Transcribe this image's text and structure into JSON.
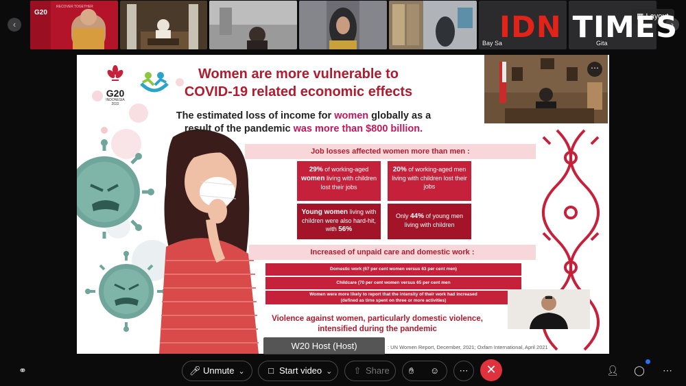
{
  "participants": [
    {
      "name": "",
      "bg": "#b3142a"
    },
    {
      "name": "",
      "bg": "#5a4632"
    },
    {
      "name": "",
      "bg": "#8c8c8c"
    },
    {
      "name": "",
      "bg": "#6f6f74"
    },
    {
      "name": "",
      "bg": "#7a7f85"
    },
    {
      "name": "Bay Sa",
      "bg": "#2b2b2d"
    },
    {
      "name": "Gita",
      "bg": "#2b2b2d"
    }
  ],
  "layout_label": "Layout",
  "watermark": {
    "part1": "IDN",
    "part2": "TIMES"
  },
  "slide": {
    "logo_text": "G20",
    "logo_sub1": "INDONESIA",
    "logo_sub2": "2022",
    "title_line1": "Women are more vulnerable to",
    "title_line2": "COVID-19 related economic effects",
    "subtitle_pre": "The estimated loss of income for ",
    "subtitle_em1": "women",
    "subtitle_mid": " globally as a result of the pandemic ",
    "subtitle_em2": "was more than $800 billion.",
    "job_losses_heading": "Job losses affected women more than men :",
    "stat1_pct": "29%",
    "stat1_a": " of working-aged ",
    "stat1_bold": "women",
    "stat1_b": " living with children lost their jobs",
    "stat2_pct": "20%",
    "stat2_text": " of working-aged men living with children lost their jobs",
    "stat3_bold": "Young women",
    "stat3_a": " living with children were also hard-hit, with ",
    "stat3_pct": "56%",
    "stat4_a": "Only ",
    "stat4_pct": "44%",
    "stat4_b": " of young men",
    "stat4_c": " living with children",
    "unpaid_heading": "Increased of unpaid care and domestic work :",
    "bar1": "Domestic work  (67 per cent women versus 63 per cent men)",
    "bar2": "Childcare (70 per cent women versus 65 per cent men",
    "bar3_line1": "Women were more likely to report that the intensity of their work had increased",
    "bar3_line2": "(defined as time spent on three or more activities)",
    "violence_line1": "Violence against women, particularly domestic violence,",
    "violence_line2": "intensified during the pandemic",
    "source": ": UN Women Report, December, 2021;  Oxfam International, April 2021"
  },
  "host_label": "W20 Host  (Host)",
  "toolbar": {
    "unmute_label": "Unmute",
    "start_video_label": "Start video",
    "share_label": "Share"
  }
}
